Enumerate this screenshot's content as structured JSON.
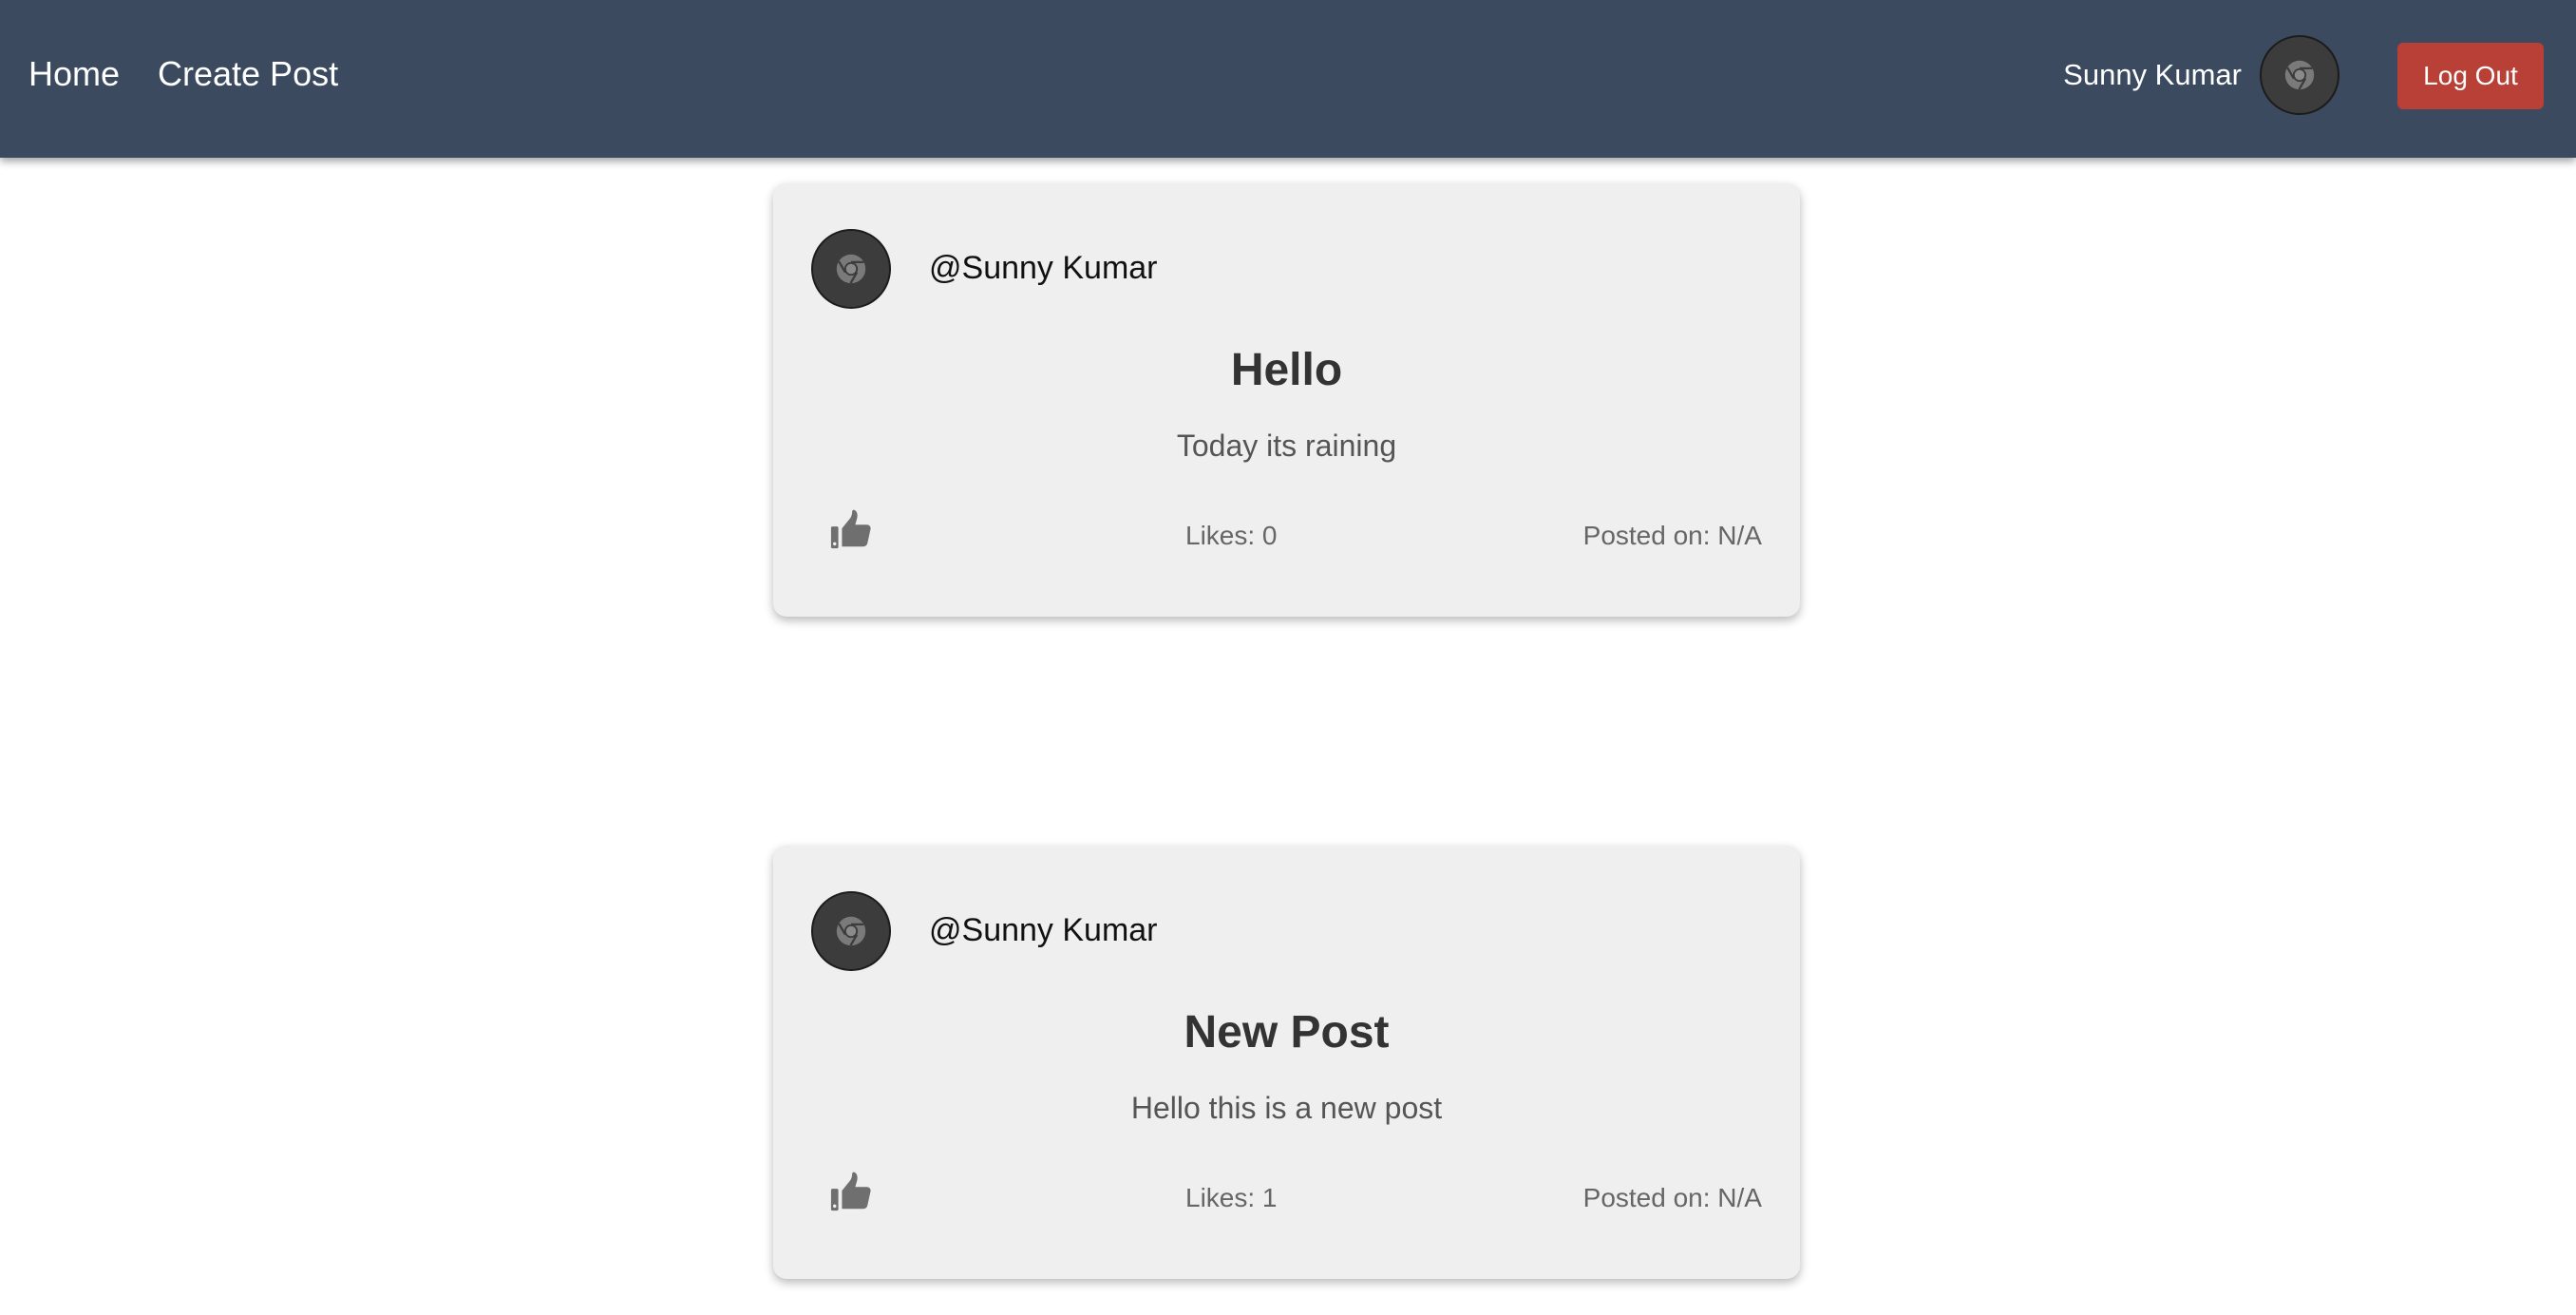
{
  "nav": {
    "home_label": "Home",
    "create_post_label": "Create Post",
    "user_name": "Sunny Kumar",
    "logout_label": "Log Out",
    "avatar_icon": "chrome-avatar-icon"
  },
  "colors": {
    "navbar_bg": "#3b4a5f",
    "logout_bg": "#b94036",
    "card_bg": "#efefef"
  },
  "posts": [
    {
      "author": "@Sunny Kumar",
      "title": "Hello",
      "body": "Today its raining",
      "likes": "Likes: 0",
      "posted_on": "Posted on: N/A",
      "like_icon": "thumbs-up-icon"
    },
    {
      "author": "@Sunny Kumar",
      "title": "New Post",
      "body": "Hello this is a new post",
      "likes": "Likes: 1",
      "posted_on": "Posted on: N/A",
      "like_icon": "thumbs-up-icon"
    }
  ]
}
